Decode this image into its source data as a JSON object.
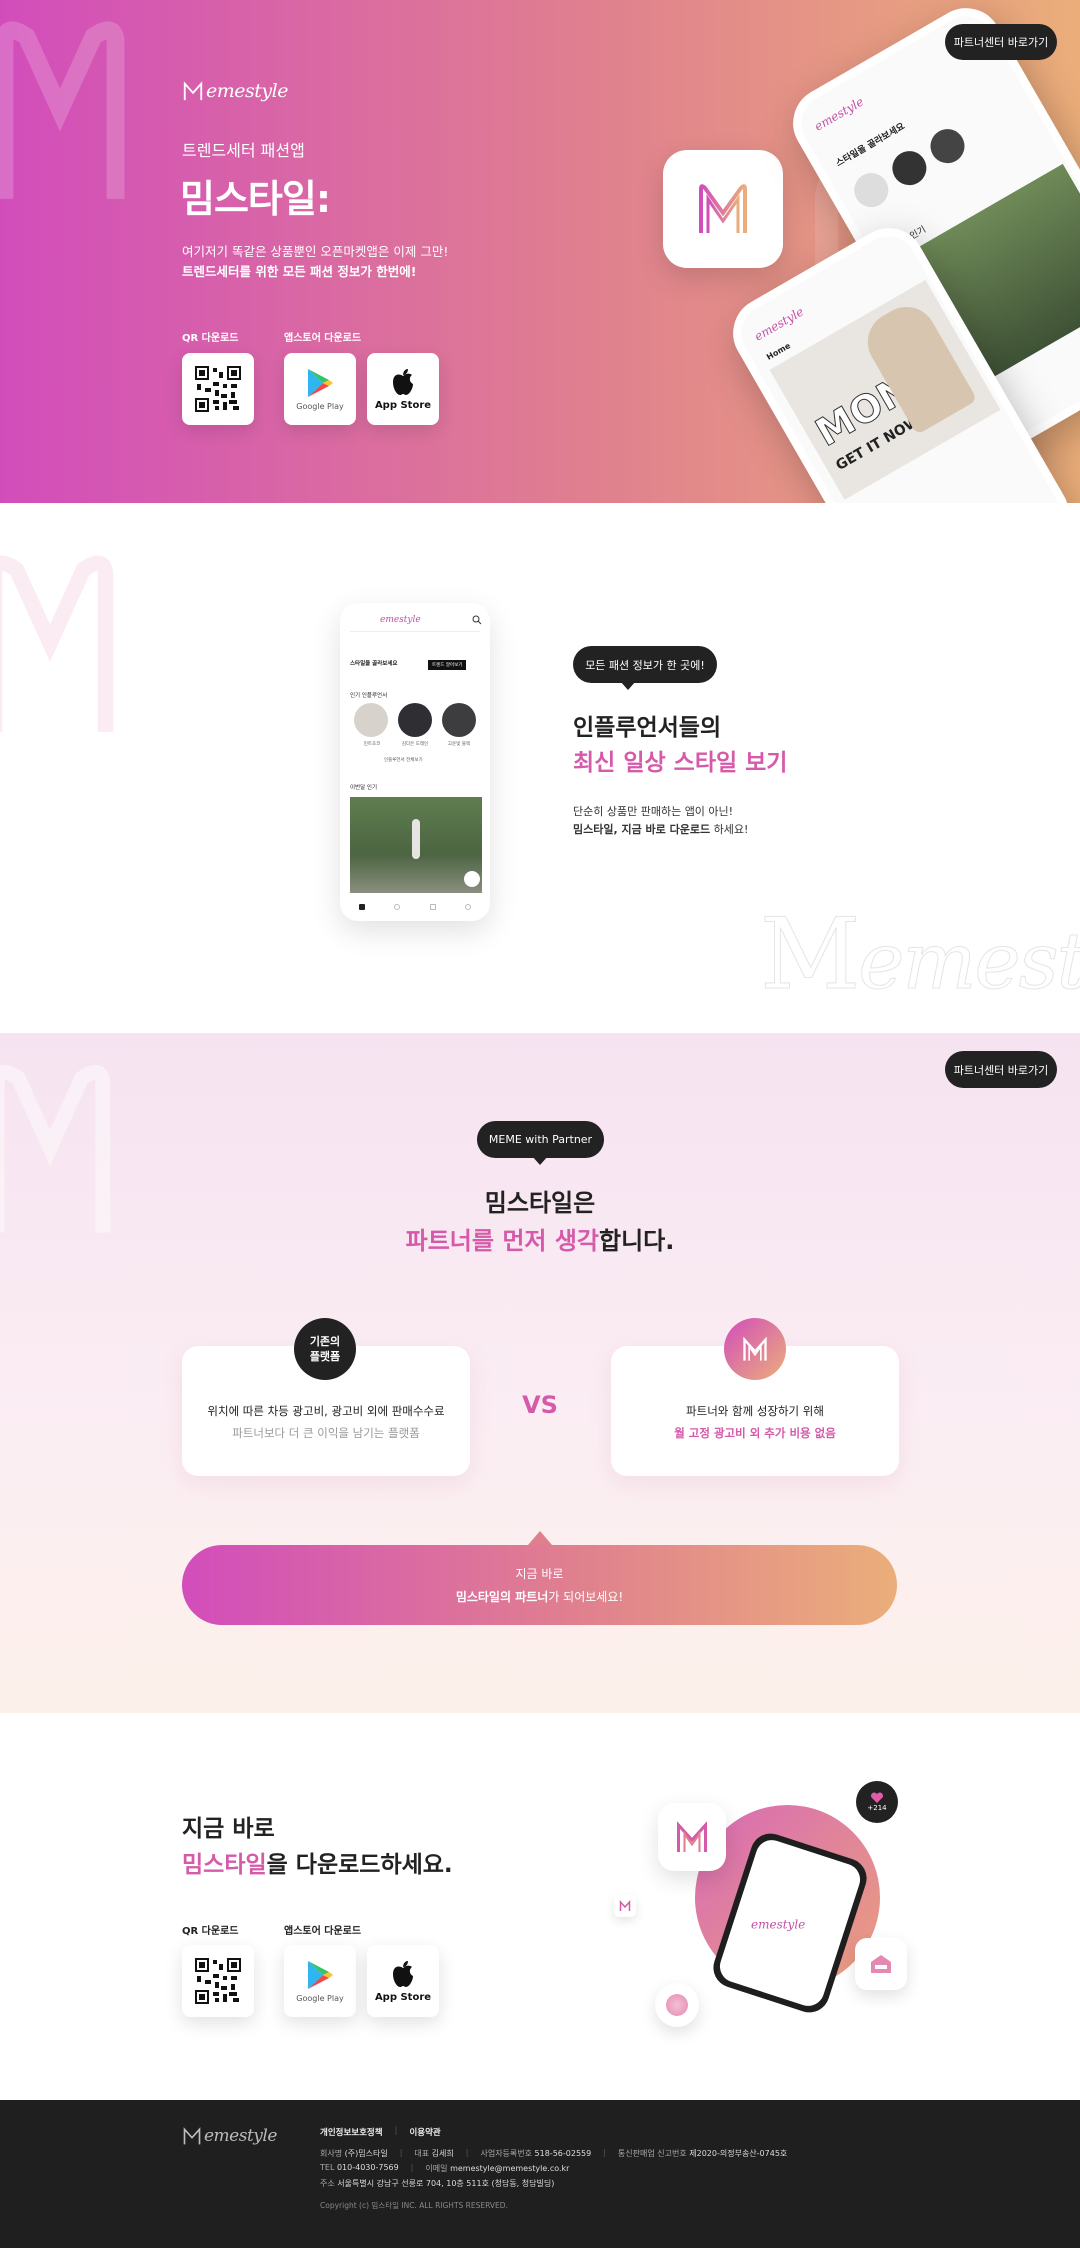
{
  "hero": {
    "brand": "emestyle",
    "subtitle": "트렌드세터 패션앱",
    "title": "밈스타일:",
    "desc_line1": "여기저기 똑같은 상품뿐인 오픈마켓앱은 이제 그만!",
    "desc_line2": "트렌드세터를 위한 모든 패션 정보가 한번에!",
    "qr_label": "QR 다운로드",
    "store_label": "앱스토어 다운로드",
    "google_play": "Google Play",
    "app_store": "App Store",
    "partner_button": "파트너센터 바로가기",
    "phone_logo": "emestyle",
    "phone_tab": "Home",
    "phone_banner": "MON",
    "phone_banner_sub": "GET IT NOW",
    "phone_headline": "스타일을 골라보세요",
    "phone_section": "이번달 인기"
  },
  "influencer": {
    "bubble": "모든 패션 정보가 한 곳에!",
    "title_line1": "인플루언서들의",
    "title_line2": "최신 일상 스타일 보기",
    "desc_line1": "단순히 상품만 판매하는 앱이 아닌!",
    "desc_line2_bold": "밈스타일, 지금 바로 다운로드",
    "desc_line2_rest": " 하세요!",
    "watermark": "emestyle",
    "phone_logo": "emestyle",
    "phone_hero_text": "스타일을 골라보세요",
    "phone_button": "트렌드 알아보기",
    "phone_section1": "인기 인플루언서",
    "phone_names": [
      "민트초코",
      "김다은 도레인",
      "고운빛 블랙"
    ],
    "phone_more": "인플루언서 전체보기",
    "phone_section2": "이번달 인기"
  },
  "partner": {
    "partner_button": "파트너센터 바로가기",
    "bubble": "MEME with Partner",
    "title_line1": "밈스타일은",
    "title_pink": "파트너를 먼저 생각",
    "title_rest": "합니다.",
    "old_badge_line1": "기존의",
    "old_badge_line2": "플랫폼",
    "old_line1": "위치에 따른 차등 광고비, 광고비 외에 판매수수료",
    "old_line2": "파트너보다 더 큰 이익을 남기는 플랫폼",
    "vs": "VS",
    "new_line1": "파트너와 함께 성장하기 위해",
    "new_line2": "월 고정 광고비 외 추가 비용 없음",
    "cta_line1": "지금 바로",
    "cta_line2_bold": "밈스타일의 파트너",
    "cta_line2_rest": "가 되어보세요!"
  },
  "download": {
    "title_line1": "지금 바로",
    "title_pink": "밈스타일",
    "title_rest": "을 다운로드하세요.",
    "qr_label": "QR 다운로드",
    "store_label": "앱스토어 다운로드",
    "google_play": "Google Play",
    "app_store": "App Store",
    "like_count": "+214",
    "phone_logo": "emestyle"
  },
  "footer": {
    "brand": "emestyle",
    "link_privacy": "개인정보보호정책",
    "link_terms": "이용약관",
    "company_label": "회사명",
    "company": "(주)밈스타일",
    "ceo_label": "대표",
    "ceo": "김세희",
    "bizno_label": "사업자등록번호",
    "bizno": "518-56-02559",
    "mailorder_label": "통신판매업 신고번호",
    "mailorder": "제2020-의정부송산-0745호",
    "tel_label": "TEL",
    "tel": "010-4030-7569",
    "email_label": "이메일",
    "email": "memestyle@memestyle.co.kr",
    "address_label": "주소",
    "address": "서울특별시 강남구 선릉로 704, 10층 511호 (청담동, 청담빌딩)",
    "copyright": "Copyright (c) 밈스타일 INC. ALL RIGHTS RESERVED."
  },
  "colors": {
    "pink": "#d24dbb",
    "peach": "#ebae7a",
    "accent_text": "#d55aa9",
    "dark": "#222222",
    "footer_bg": "#1f1f1f"
  }
}
